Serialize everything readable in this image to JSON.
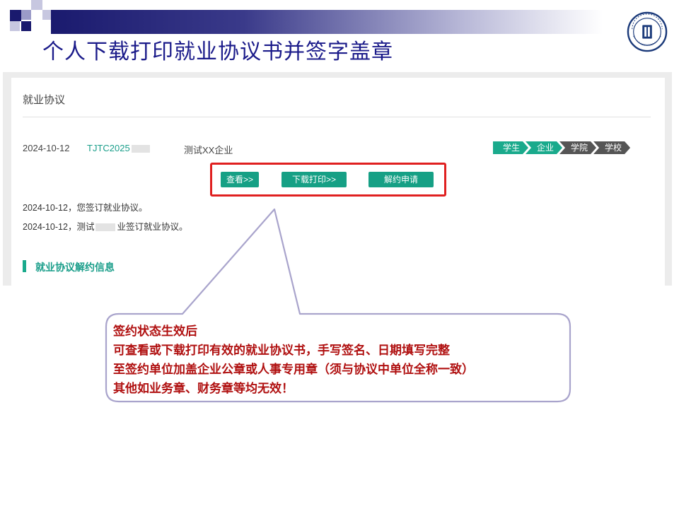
{
  "slide": {
    "title": "个人下载打印就业协议书并签字盖章",
    "logo_icon": "university-seal-icon"
  },
  "panel": {
    "header": "就业协议",
    "record": {
      "date": "2024-10-12",
      "code": "TJTC2025",
      "company": "测试XX企业"
    },
    "steps": [
      {
        "label": "学生",
        "state": "done"
      },
      {
        "label": "企业",
        "state": "done"
      },
      {
        "label": "学院",
        "state": "pending"
      },
      {
        "label": "学校",
        "state": "pending"
      }
    ],
    "buttons": {
      "view": "查看>>",
      "download": "下载打印>>",
      "terminate": "解约申请"
    },
    "log": [
      "2024-10-12，您签订就业协议。",
      "2024-10-12，测试",
      "业签订就业协议。"
    ],
    "section_title": "就业协议解约信息"
  },
  "callout": {
    "lines": [
      "签约状态生效后",
      "可查看或下载打印有效的就业协议书，手写签名、日期填写完整",
      "至签约单位加盖企业公章或人事专用章（须与协议中单位全称一致）",
      "其他如业务章、财务章等均无效！"
    ]
  },
  "colors": {
    "accent": "#16a085",
    "title": "#1b1b8a",
    "highlight_border": "#e02020",
    "callout_text": "#b01010",
    "callout_border": "#a9a4cc"
  }
}
